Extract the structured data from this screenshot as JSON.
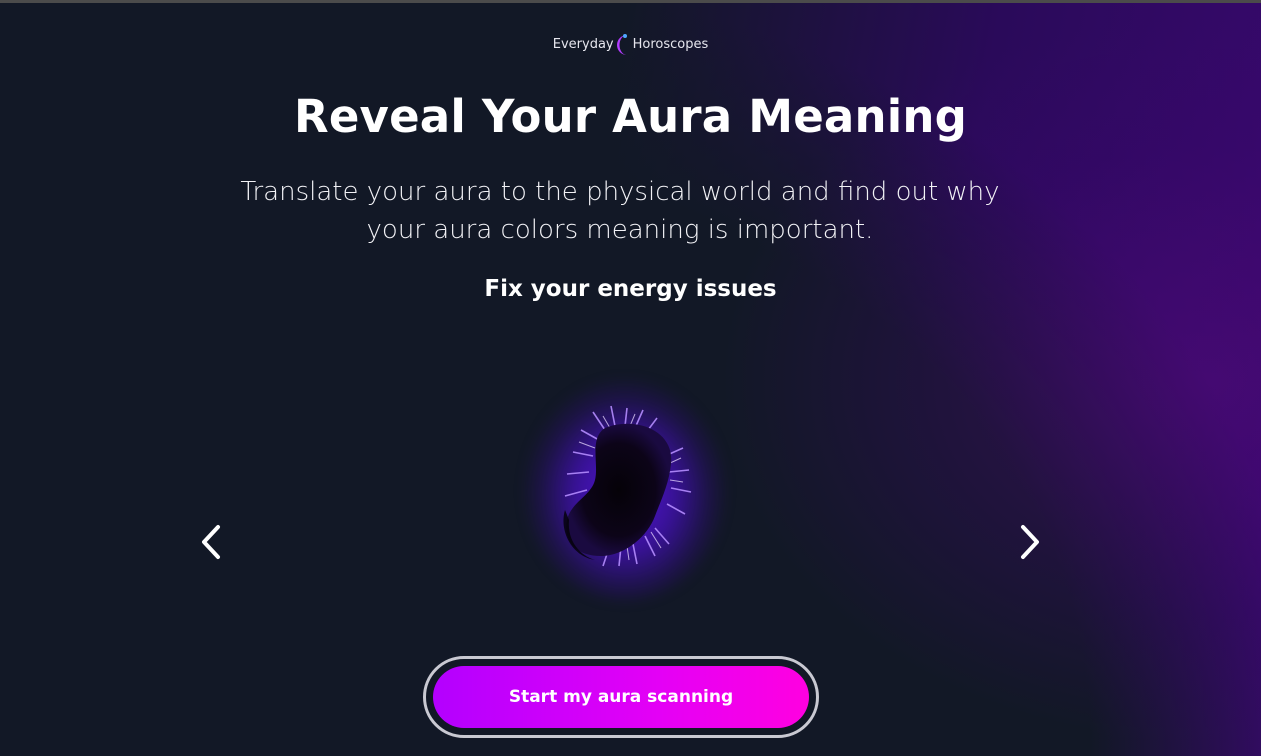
{
  "brand": {
    "left": "Everyday",
    "right": "Horoscopes",
    "icon": "crescent-moon-icon"
  },
  "hero": {
    "title": "Reveal Your Aura Meaning",
    "subtitle": "Translate your aura to the physical world and find out why your aura colors meaning is important.",
    "tagline": "Fix your energy issues"
  },
  "carousel": {
    "prev_icon": "chevron-left-icon",
    "next_icon": "chevron-right-icon",
    "image": "aura-image"
  },
  "cta": {
    "label": "Start my aura scanning"
  },
  "colors": {
    "background": "#121826",
    "accent_start": "#b300ff",
    "accent_end": "#ff00e0",
    "aura_glow": "#5514dc"
  }
}
